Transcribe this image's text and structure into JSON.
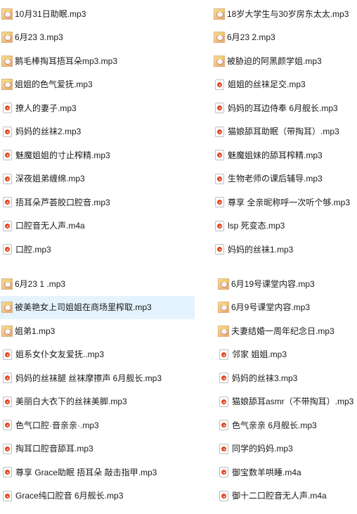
{
  "groups": [
    {
      "items": [
        {
          "icon": "album-art-icon",
          "name": "10月31日助眠.mp3"
        },
        {
          "icon": "album-art-icon",
          "name": "6月23 3.mp3"
        },
        {
          "icon": "album-art-icon",
          "name": "鹅毛棒掏耳捂耳朵mp3.mp3"
        },
        {
          "icon": "album-art-icon",
          "name": "姐姐的色气爱抚.mp3"
        },
        {
          "icon": "media-file-icon",
          "name": "撩人的妻子.mp3"
        },
        {
          "icon": "media-file-icon",
          "name": "妈妈的丝袜2.mp3"
        },
        {
          "icon": "media-file-icon",
          "name": "魅魔姐姐的寸止榨精.mp3"
        },
        {
          "icon": "media-file-icon",
          "name": "深夜姐弟缠绵.mp3"
        },
        {
          "icon": "media-file-icon",
          "name": "捂耳朵芦荟胶口腔音.mp3"
        },
        {
          "icon": "media-file-icon",
          "name": "口腔音无人声.m4a"
        },
        {
          "icon": "media-file-icon",
          "name": "口腔.mp3"
        }
      ]
    },
    {
      "items": [
        {
          "icon": "album-art-icon",
          "name": "18岁大学生与30岁房东太太.mp3"
        },
        {
          "icon": "album-art-icon",
          "name": "6月23 2.mp3"
        },
        {
          "icon": "album-art-icon",
          "name": "被胁迫的阿黑颜学姐.mp3"
        },
        {
          "icon": "media-file-icon",
          "name": "姐姐的丝袜足交.mp3"
        },
        {
          "icon": "media-file-icon",
          "name": "妈妈的耳边侍奉 6月舰长.mp3"
        },
        {
          "icon": "media-file-icon",
          "name": "猫娘舔耳助眠（带掏耳）.mp3"
        },
        {
          "icon": "media-file-icon",
          "name": "魅魔姐妹的舔耳榨精.mp3"
        },
        {
          "icon": "media-file-icon",
          "name": "生物老师の课后辅导.mp3"
        },
        {
          "icon": "media-file-icon",
          "name": "尊享 全亲昵称呼一次听个够.mp3"
        },
        {
          "icon": "media-file-icon",
          "name": "lsp 死变态.mp3"
        },
        {
          "icon": "media-file-icon",
          "name": "妈妈的丝袜1.mp3"
        }
      ]
    },
    {
      "items": [
        {
          "icon": "album-art-icon",
          "name": "6月23 1 .mp3"
        },
        {
          "icon": "album-art-icon",
          "name": "被美艳女上司姐姐在商场里榨取.mp3",
          "selected": true
        },
        {
          "icon": "album-art-icon",
          "name": "姐弟1.mp3"
        },
        {
          "icon": "media-file-icon",
          "name": "姐系女仆女友爱抚..mp3"
        },
        {
          "icon": "media-file-icon",
          "name": "妈妈的丝袜腿 丝袜摩擦声 6月舰长.mp3"
        },
        {
          "icon": "media-file-icon",
          "name": "美丽白大衣下的丝袜美脚.mp3"
        },
        {
          "icon": "media-file-icon",
          "name": "色气口腔·音亲亲·.mp3"
        },
        {
          "icon": "media-file-icon",
          "name": "掏耳口腔音舔耳.mp3"
        },
        {
          "icon": "media-file-icon",
          "name": "尊享 Grace助眠 捂耳朵 敲击指甲.mp3"
        },
        {
          "icon": "media-file-icon",
          "name": "Grace纯口腔音 6月舰长.mp3"
        }
      ]
    },
    {
      "items": [
        {
          "icon": "album-art-icon",
          "name": "6月19号课堂内容.mp3"
        },
        {
          "icon": "album-art-icon",
          "name": "6月9号课堂内容.mp3"
        },
        {
          "icon": "album-art-icon",
          "name": "夫妻结婚一周年纪念日.mp3"
        },
        {
          "icon": "media-file-icon",
          "name": "邻家 姐姐.mp3"
        },
        {
          "icon": "media-file-icon",
          "name": "妈妈的丝袜3.mp3"
        },
        {
          "icon": "media-file-icon",
          "name": "猫娘舔耳asmr（不带掏耳）.mp3"
        },
        {
          "icon": "media-file-icon",
          "name": "色气亲亲 6月舰长.mp3"
        },
        {
          "icon": "media-file-icon",
          "name": "同学的妈妈.mp3"
        },
        {
          "icon": "media-file-icon",
          "name": "御宝数羊哄睡.m4a"
        },
        {
          "icon": "media-file-icon",
          "name": "御十二口腔音无人声.m4a"
        }
      ]
    }
  ]
}
